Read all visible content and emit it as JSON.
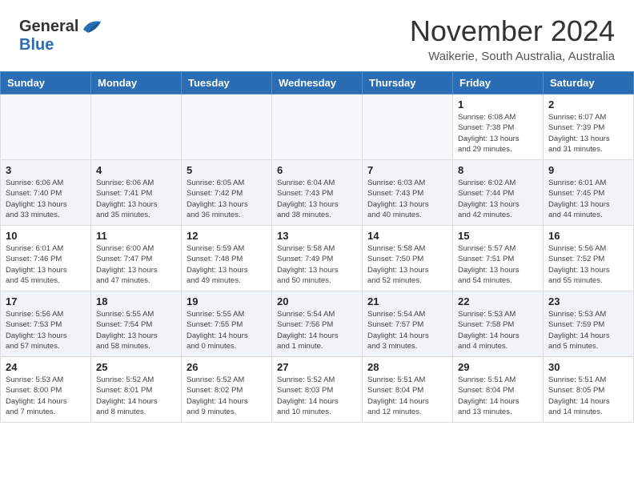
{
  "header": {
    "logo": {
      "general": "General",
      "blue": "Blue"
    },
    "title": "November 2024",
    "subtitle": "Waikerie, South Australia, Australia"
  },
  "calendar": {
    "days_of_week": [
      "Sunday",
      "Monday",
      "Tuesday",
      "Wednesday",
      "Thursday",
      "Friday",
      "Saturday"
    ],
    "weeks": [
      [
        {
          "day": null,
          "info": null
        },
        {
          "day": null,
          "info": null
        },
        {
          "day": null,
          "info": null
        },
        {
          "day": null,
          "info": null
        },
        {
          "day": null,
          "info": null
        },
        {
          "day": "1",
          "info": "Sunrise: 6:08 AM\nSunset: 7:38 PM\nDaylight: 13 hours\nand 29 minutes."
        },
        {
          "day": "2",
          "info": "Sunrise: 6:07 AM\nSunset: 7:39 PM\nDaylight: 13 hours\nand 31 minutes."
        }
      ],
      [
        {
          "day": "3",
          "info": "Sunrise: 6:06 AM\nSunset: 7:40 PM\nDaylight: 13 hours\nand 33 minutes."
        },
        {
          "day": "4",
          "info": "Sunrise: 6:06 AM\nSunset: 7:41 PM\nDaylight: 13 hours\nand 35 minutes."
        },
        {
          "day": "5",
          "info": "Sunrise: 6:05 AM\nSunset: 7:42 PM\nDaylight: 13 hours\nand 36 minutes."
        },
        {
          "day": "6",
          "info": "Sunrise: 6:04 AM\nSunset: 7:43 PM\nDaylight: 13 hours\nand 38 minutes."
        },
        {
          "day": "7",
          "info": "Sunrise: 6:03 AM\nSunset: 7:43 PM\nDaylight: 13 hours\nand 40 minutes."
        },
        {
          "day": "8",
          "info": "Sunrise: 6:02 AM\nSunset: 7:44 PM\nDaylight: 13 hours\nand 42 minutes."
        },
        {
          "day": "9",
          "info": "Sunrise: 6:01 AM\nSunset: 7:45 PM\nDaylight: 13 hours\nand 44 minutes."
        }
      ],
      [
        {
          "day": "10",
          "info": "Sunrise: 6:01 AM\nSunset: 7:46 PM\nDaylight: 13 hours\nand 45 minutes."
        },
        {
          "day": "11",
          "info": "Sunrise: 6:00 AM\nSunset: 7:47 PM\nDaylight: 13 hours\nand 47 minutes."
        },
        {
          "day": "12",
          "info": "Sunrise: 5:59 AM\nSunset: 7:48 PM\nDaylight: 13 hours\nand 49 minutes."
        },
        {
          "day": "13",
          "info": "Sunrise: 5:58 AM\nSunset: 7:49 PM\nDaylight: 13 hours\nand 50 minutes."
        },
        {
          "day": "14",
          "info": "Sunrise: 5:58 AM\nSunset: 7:50 PM\nDaylight: 13 hours\nand 52 minutes."
        },
        {
          "day": "15",
          "info": "Sunrise: 5:57 AM\nSunset: 7:51 PM\nDaylight: 13 hours\nand 54 minutes."
        },
        {
          "day": "16",
          "info": "Sunrise: 5:56 AM\nSunset: 7:52 PM\nDaylight: 13 hours\nand 55 minutes."
        }
      ],
      [
        {
          "day": "17",
          "info": "Sunrise: 5:56 AM\nSunset: 7:53 PM\nDaylight: 13 hours\nand 57 minutes."
        },
        {
          "day": "18",
          "info": "Sunrise: 5:55 AM\nSunset: 7:54 PM\nDaylight: 13 hours\nand 58 minutes."
        },
        {
          "day": "19",
          "info": "Sunrise: 5:55 AM\nSunset: 7:55 PM\nDaylight: 14 hours\nand 0 minutes."
        },
        {
          "day": "20",
          "info": "Sunrise: 5:54 AM\nSunset: 7:56 PM\nDaylight: 14 hours\nand 1 minute."
        },
        {
          "day": "21",
          "info": "Sunrise: 5:54 AM\nSunset: 7:57 PM\nDaylight: 14 hours\nand 3 minutes."
        },
        {
          "day": "22",
          "info": "Sunrise: 5:53 AM\nSunset: 7:58 PM\nDaylight: 14 hours\nand 4 minutes."
        },
        {
          "day": "23",
          "info": "Sunrise: 5:53 AM\nSunset: 7:59 PM\nDaylight: 14 hours\nand 5 minutes."
        }
      ],
      [
        {
          "day": "24",
          "info": "Sunrise: 5:53 AM\nSunset: 8:00 PM\nDaylight: 14 hours\nand 7 minutes."
        },
        {
          "day": "25",
          "info": "Sunrise: 5:52 AM\nSunset: 8:01 PM\nDaylight: 14 hours\nand 8 minutes."
        },
        {
          "day": "26",
          "info": "Sunrise: 5:52 AM\nSunset: 8:02 PM\nDaylight: 14 hours\nand 9 minutes."
        },
        {
          "day": "27",
          "info": "Sunrise: 5:52 AM\nSunset: 8:03 PM\nDaylight: 14 hours\nand 10 minutes."
        },
        {
          "day": "28",
          "info": "Sunrise: 5:51 AM\nSunset: 8:04 PM\nDaylight: 14 hours\nand 12 minutes."
        },
        {
          "day": "29",
          "info": "Sunrise: 5:51 AM\nSunset: 8:04 PM\nDaylight: 14 hours\nand 13 minutes."
        },
        {
          "day": "30",
          "info": "Sunrise: 5:51 AM\nSunset: 8:05 PM\nDaylight: 14 hours\nand 14 minutes."
        }
      ]
    ]
  }
}
